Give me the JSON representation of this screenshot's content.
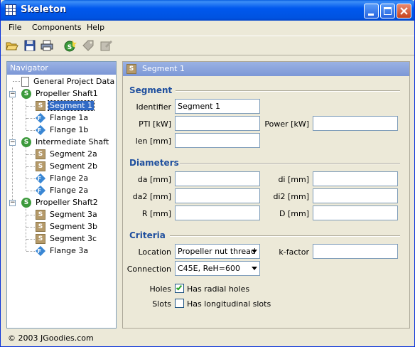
{
  "window": {
    "title": "Skeleton"
  },
  "menu": [
    {
      "label": "File"
    },
    {
      "label": "Components"
    },
    {
      "label": "Help"
    }
  ],
  "toolbar": {
    "icons": [
      "open-folder-icon",
      "save-icon",
      "print-icon",
      "add-segment-icon",
      "tag-icon",
      "edit-icon"
    ]
  },
  "navigator": {
    "title": "Navigator",
    "items": [
      {
        "label": "General Project Data",
        "type": "doc",
        "level": 0
      },
      {
        "label": "Propeller Shaft1",
        "type": "shaft",
        "level": 0,
        "expanded": true
      },
      {
        "label": "Segment 1",
        "type": "segment",
        "level": 1,
        "selected": true
      },
      {
        "label": "Flange 1a",
        "type": "flange",
        "level": 1
      },
      {
        "label": "Flange 1b",
        "type": "flange",
        "level": 1
      },
      {
        "label": "Intermediate Shaft",
        "type": "shaft",
        "level": 0,
        "expanded": true
      },
      {
        "label": "Segment 2a",
        "type": "segment",
        "level": 1
      },
      {
        "label": "Segment 2b",
        "type": "segment",
        "level": 1
      },
      {
        "label": "Flange 2a",
        "type": "flange",
        "level": 1
      },
      {
        "label": "Flange 2a",
        "type": "flange",
        "level": 1
      },
      {
        "label": "Propeller Shaft2",
        "type": "shaft",
        "level": 0,
        "expanded": true
      },
      {
        "label": "Segment 3a",
        "type": "segment",
        "level": 1
      },
      {
        "label": "Segment 3b",
        "type": "segment",
        "level": 1
      },
      {
        "label": "Segment 3c",
        "type": "segment",
        "level": 1
      },
      {
        "label": "Flange 3a",
        "type": "flange",
        "level": 1
      }
    ]
  },
  "form": {
    "header": "Segment 1",
    "icon_letter": "S",
    "segment": {
      "title": "Segment",
      "identifier_label": "Identifier",
      "identifier_value": "Segment 1",
      "pti_label": "PTI [kW]",
      "pti_value": "",
      "power_label": "Power [kW]",
      "power_value": "",
      "len_label": "len [mm]",
      "len_value": ""
    },
    "diameters": {
      "title": "Diameters",
      "da_label": "da [mm]",
      "da_value": "",
      "di_label": "di [mm]",
      "di_value": "",
      "da2_label": "da2 [mm]",
      "da2_value": "",
      "di2_label": "di2 [mm]",
      "di2_value": "",
      "r_label": "R [mm]",
      "r_value": "",
      "d_label": "D [mm]",
      "d_value": ""
    },
    "criteria": {
      "title": "Criteria",
      "location_label": "Location",
      "location_value": "Propeller nut thread",
      "kfactor_label": "k-factor",
      "kfactor_value": "",
      "connection_label": "Connection",
      "connection_value": "C45E, ReH=600",
      "holes_label": "Holes",
      "holes_text": "Has radial holes",
      "holes_checked": true,
      "slots_label": "Slots",
      "slots_text": "Has longitudinal slots",
      "slots_checked": false
    }
  },
  "status": {
    "text": "© 2003 JGoodies.com"
  },
  "colors": {
    "title_bar": "#0058ee",
    "section_title": "#1f4f9e",
    "selection": "#316ac5"
  }
}
